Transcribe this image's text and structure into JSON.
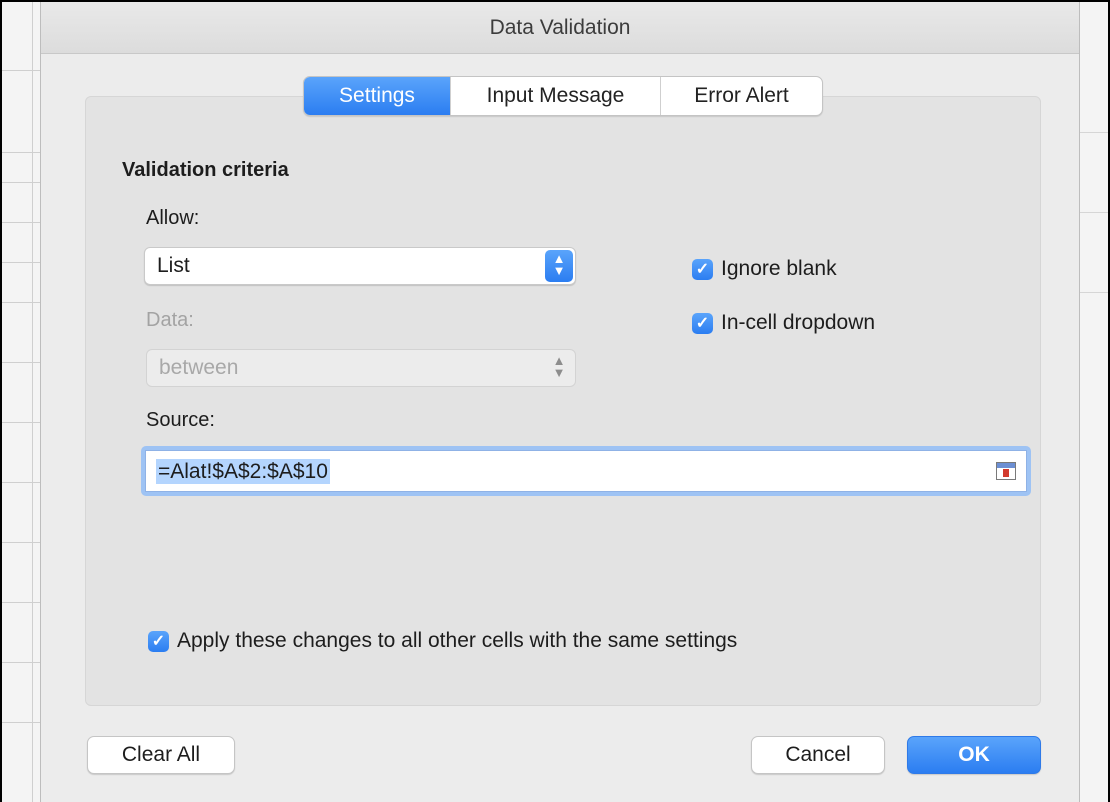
{
  "window": {
    "title": "Data Validation"
  },
  "tabs": [
    {
      "label": "Settings",
      "active": true
    },
    {
      "label": "Input Message",
      "active": false
    },
    {
      "label": "Error Alert",
      "active": false
    }
  ],
  "criteria": {
    "section_title": "Validation criteria",
    "allow_label": "Allow:",
    "allow_value": "List",
    "data_label": "Data:",
    "data_value": "between",
    "source_label": "Source:",
    "source_value": "=Alat!$A$2:$A$10"
  },
  "options": {
    "ignore_blank": {
      "label": "Ignore blank",
      "checked": true
    },
    "in_cell_dropdown": {
      "label": "In-cell dropdown",
      "checked": true
    },
    "apply_all": {
      "label": "Apply these changes to all other cells with the same settings",
      "checked": true
    }
  },
  "buttons": {
    "clear_all": "Clear All",
    "cancel": "Cancel",
    "ok": "OK"
  },
  "icons": {
    "checkmark": "✓",
    "select_arrows": "⌃⌄",
    "range_picker": "range-select-icon"
  },
  "colors": {
    "accent": "#2b7df1",
    "dialog_bg": "#ececec",
    "panel_bg": "#e3e3e3",
    "selection": "#b4d5fe"
  }
}
